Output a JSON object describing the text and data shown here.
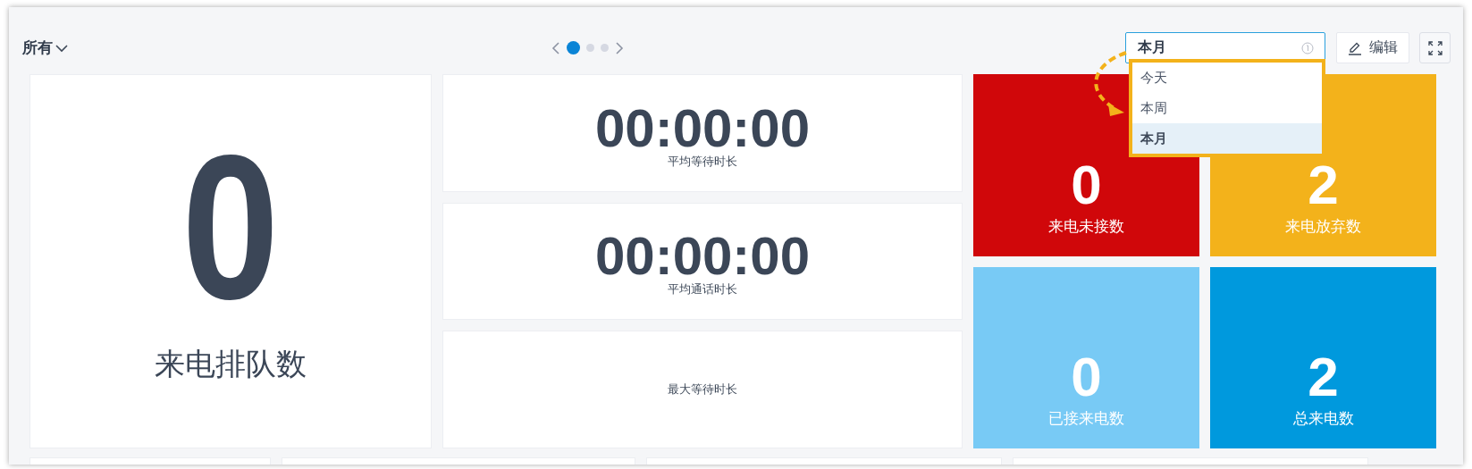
{
  "header": {
    "filter": {
      "label": "所有"
    },
    "pager": [
      {
        "selected": true
      },
      {
        "selected": false
      },
      {
        "selected": false
      }
    ],
    "period_select": {
      "value": "本月",
      "expanded": true,
      "options": [
        {
          "label": "今天",
          "selected": false
        },
        {
          "label": "本周",
          "selected": false
        },
        {
          "label": "本月",
          "selected": true
        }
      ]
    },
    "edit_button": "编辑"
  },
  "queue": {
    "value": "0",
    "label": "来电排队数"
  },
  "durations": [
    {
      "value": "00:00:00",
      "label": "平均等待时长"
    },
    {
      "value": "00:00:00",
      "label": "平均通话时长"
    },
    {
      "label": "最大等待时长"
    }
  ],
  "tiles": [
    {
      "value": "0",
      "label": "来电未接数",
      "color": "#d0070a"
    },
    {
      "value": "2",
      "label": "来电放弃数",
      "color": "#f3b21b"
    },
    {
      "value": "0",
      "label": "已接来电数",
      "color": "#78caf5"
    },
    {
      "value": "2",
      "label": "总来电数",
      "color": "#0099dd"
    }
  ]
}
